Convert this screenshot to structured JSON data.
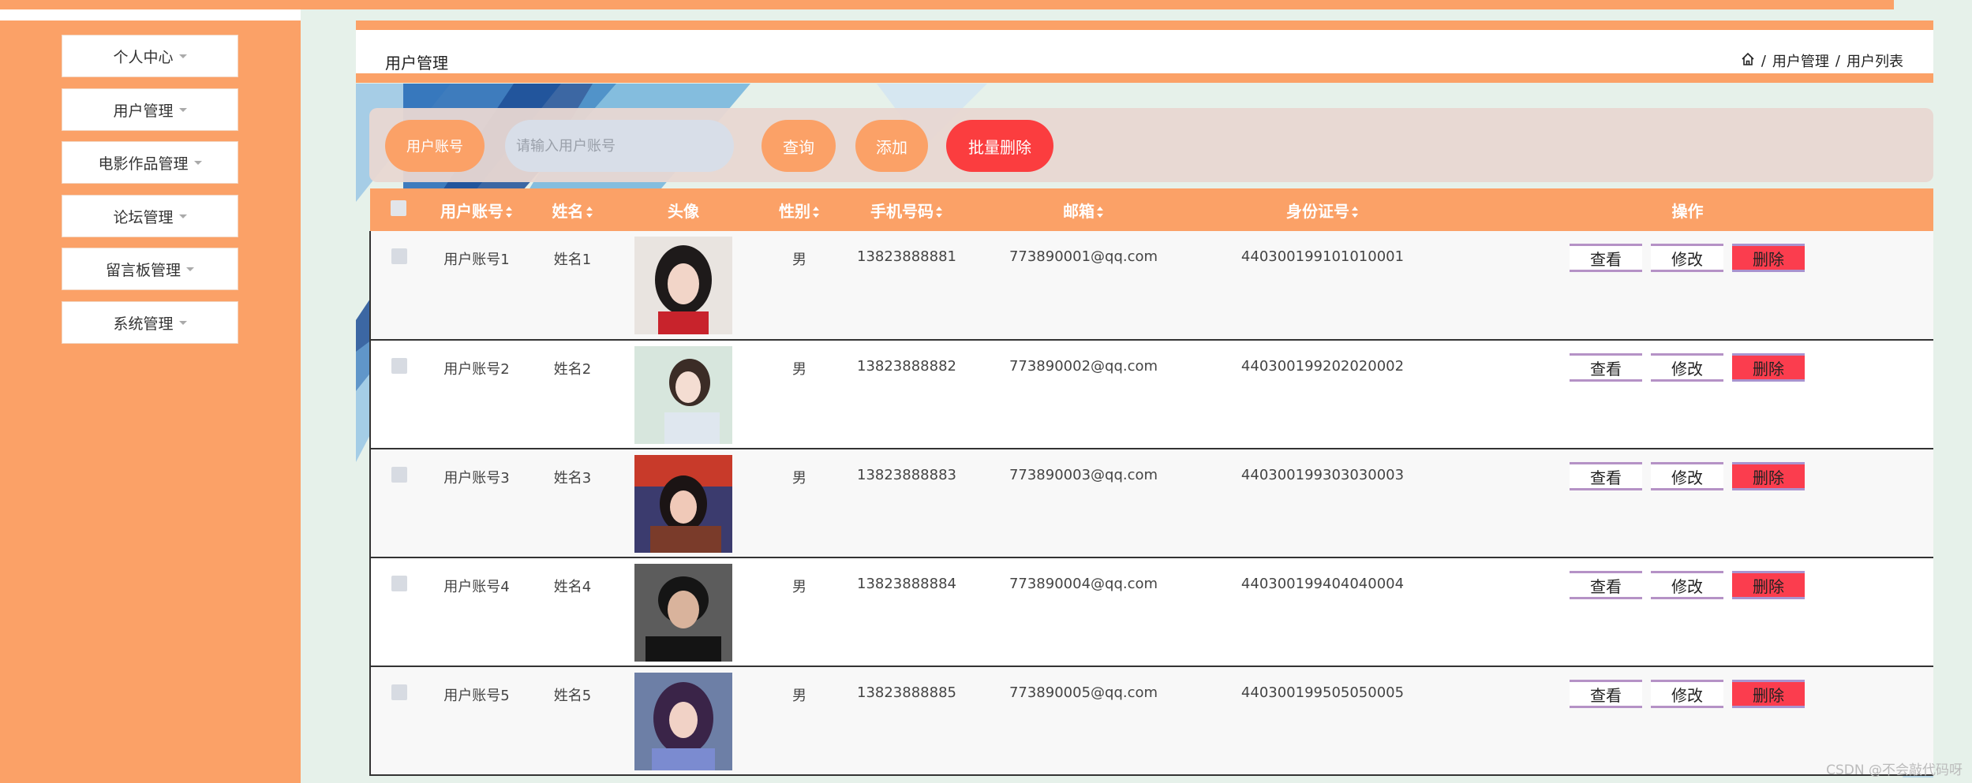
{
  "sidebar": {
    "items": [
      {
        "label": "个人中心"
      },
      {
        "label": "用户管理"
      },
      {
        "label": "电影作品管理"
      },
      {
        "label": "论坛管理"
      },
      {
        "label": "留言板管理"
      },
      {
        "label": "系统管理"
      }
    ]
  },
  "header": {
    "title": "用户管理",
    "breadcrumb": [
      "用户管理",
      "用户列表"
    ],
    "separator": "/"
  },
  "search": {
    "label": "用户账号",
    "placeholder": "请输入用户账号",
    "query_label": "查询",
    "add_label": "添加",
    "batch_delete_label": "批量删除"
  },
  "table": {
    "headers": {
      "account": "用户账号",
      "name": "姓名",
      "avatar": "头像",
      "gender": "性别",
      "phone": "手机号码",
      "email": "邮箱",
      "id_number": "身份证号",
      "actions": "操作"
    },
    "rows": [
      {
        "account": "用户账号1",
        "name": "姓名1",
        "gender": "男",
        "phone": "13823888881",
        "email": "773890001@qq.com",
        "id_number": "440300199101010001"
      },
      {
        "account": "用户账号2",
        "name": "姓名2",
        "gender": "男",
        "phone": "13823888882",
        "email": "773890002@qq.com",
        "id_number": "440300199202020002"
      },
      {
        "account": "用户账号3",
        "name": "姓名3",
        "gender": "男",
        "phone": "13823888883",
        "email": "773890003@qq.com",
        "id_number": "440300199303030003"
      },
      {
        "account": "用户账号4",
        "name": "姓名4",
        "gender": "男",
        "phone": "13823888884",
        "email": "773890004@qq.com",
        "id_number": "440300199404040004"
      },
      {
        "account": "用户账号5",
        "name": "姓名5",
        "gender": "男",
        "phone": "13823888885",
        "email": "773890005@qq.com",
        "id_number": "440300199505050005"
      }
    ],
    "action_labels": {
      "view": "查看",
      "edit": "修改",
      "delete": "删除"
    }
  },
  "watermark": "CSDN @不会敲代码呀",
  "colors": {
    "accent": "#fba167",
    "danger": "#fb3d3f",
    "background": "#e6f1ea"
  }
}
